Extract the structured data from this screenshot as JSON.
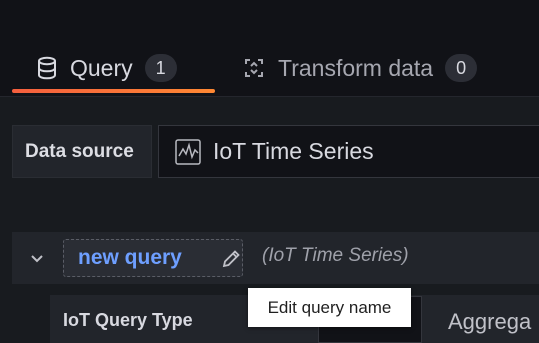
{
  "tabs": [
    {
      "label": "Query",
      "count": "1",
      "icon": "database-icon",
      "active": true
    },
    {
      "label": "Transform data",
      "count": "0",
      "icon": "transform-icon",
      "active": false
    }
  ],
  "datasource": {
    "label": "Data source",
    "name": "IoT Time Series",
    "icon": "iot-chart-icon"
  },
  "query": {
    "name": "new query",
    "datasource_hint": "(IoT Time Series)"
  },
  "editor": {
    "query_type_label": "IoT Query Type",
    "aggregation_label": "Aggrega"
  },
  "tooltip": {
    "text": "Edit query name"
  },
  "colors": {
    "accent": "#f55f3e",
    "link": "#6e9fff",
    "background": "#111217"
  }
}
